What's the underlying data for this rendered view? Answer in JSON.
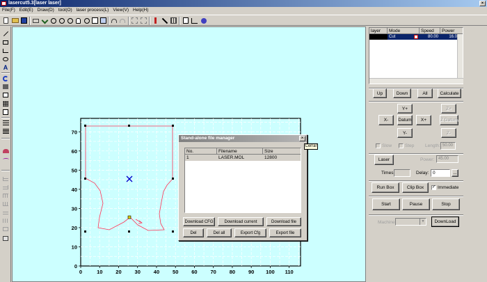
{
  "window": {
    "title": "lasercut5.3[laser laser]"
  },
  "menu": [
    "File(F)",
    "Edit(E)",
    "Draw(D)",
    "tool(O)",
    "laser process(L)",
    "View(V)",
    "Help(H)"
  ],
  "layers": {
    "headers": [
      "layer",
      "Mode",
      "Speed",
      "Power"
    ],
    "rows": [
      {
        "color": "#000000",
        "mode": "Cut",
        "speed": "80.00",
        "power": "16.0"
      }
    ]
  },
  "buttons": {
    "up": "Up",
    "down": "Down",
    "all": "All",
    "calculate": "Calculate",
    "y_plus": "Y+",
    "y_minus": "Y-",
    "x_minus": "X-",
    "x_plus": "X+",
    "datum": "Datum",
    "z_plus": "Z+",
    "z_minus": "Z-",
    "z_datum": "Z Datum",
    "laser": "Laser",
    "more": "...",
    "run_box": "Run Box",
    "clip_box": "Clip Box",
    "start": "Start",
    "pause": "Pause",
    "stop": "Stop",
    "download": "DownLoad"
  },
  "controls": {
    "slow_label": "Slow",
    "step_label": "Step",
    "length_label": "Length:",
    "length_value": "50.00",
    "power_label": "Power:",
    "power_value": "45.00",
    "times_label": "Times:",
    "times_value": "",
    "delay_label": "Delay:",
    "delay_value": "0",
    "immediate_label": "Immediate",
    "machine_label": "Machine:"
  },
  "dialog": {
    "title": "Stand-alone file manager",
    "close_tooltip": "Cerrar",
    "columns": [
      "No.",
      "Filename",
      "Size"
    ],
    "files": [
      {
        "no": "1",
        "name": "LASER.MOL",
        "size": "12800"
      }
    ],
    "buttons": {
      "download_cfg": "Download CFG",
      "download_current": "Download current",
      "download_file": "Download file",
      "del": "Del",
      "del_all": "Del all",
      "export_cfg": "Export Cfg",
      "export_file": "Export file"
    }
  },
  "chart_data": {
    "type": "grid-plot",
    "x_ticks": [
      "0",
      "10",
      "20",
      "30",
      "40",
      "50",
      "60",
      "70",
      "80",
      "90",
      "100",
      "110"
    ],
    "y_ticks": [
      "0",
      "10",
      "20",
      "30",
      "40",
      "50",
      "60",
      "70"
    ],
    "xlim": [
      0,
      116
    ],
    "ylim": [
      0,
      77
    ]
  }
}
